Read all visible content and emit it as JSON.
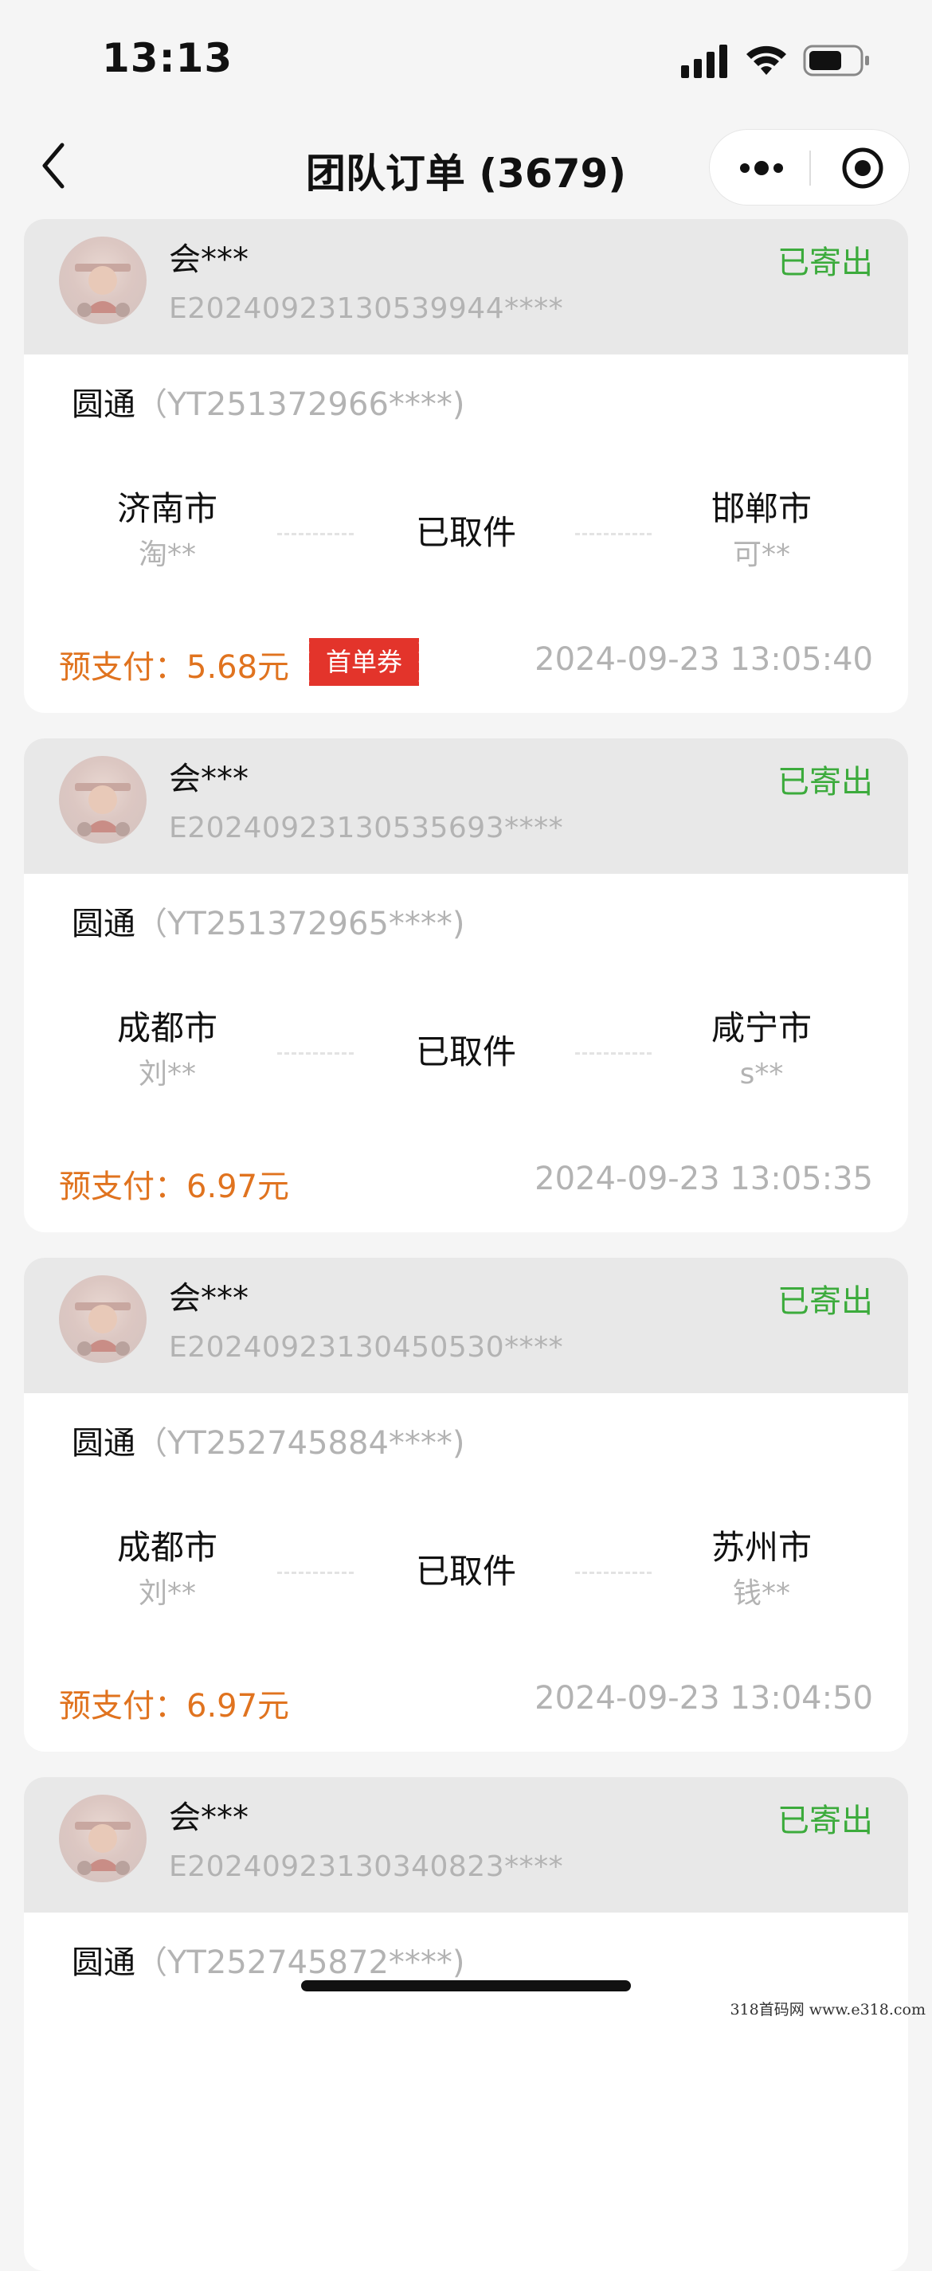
{
  "status_bar": {
    "time": "13:13"
  },
  "nav": {
    "title": "团队订单 (3679)"
  },
  "orders": [
    {
      "user": "会***",
      "order_no": "E20240923130539944****",
      "status": "已寄出",
      "carrier": "圆通",
      "tracking": "（YT251372966****)",
      "from_city": "济南市",
      "from_person": "淘**",
      "to_city": "邯郸市",
      "to_person": "可**",
      "pickup_status": "已取件",
      "prepay": "预支付：5.68元",
      "coupon": "首单券",
      "time": "2024-09-23 13:05:40"
    },
    {
      "user": "会***",
      "order_no": "E20240923130535693****",
      "status": "已寄出",
      "carrier": "圆通",
      "tracking": "（YT251372965****)",
      "from_city": "成都市",
      "from_person": "刘**",
      "to_city": "咸宁市",
      "to_person": "s**",
      "pickup_status": "已取件",
      "prepay": "预支付：6.97元",
      "time": "2024-09-23 13:05:35"
    },
    {
      "user": "会***",
      "order_no": "E20240923130450530****",
      "status": "已寄出",
      "carrier": "圆通",
      "tracking": "（YT252745884****)",
      "from_city": "成都市",
      "from_person": "刘**",
      "to_city": "苏州市",
      "to_person": "钱**",
      "pickup_status": "已取件",
      "prepay": "预支付：6.97元",
      "time": "2024-09-23 13:04:50"
    },
    {
      "user": "会***",
      "order_no": "E20240923130340823****",
      "status": "已寄出",
      "carrier": "圆通",
      "tracking": "（YT252745872****)"
    }
  ],
  "watermark": "318首码网  www.e318.com",
  "colors": {
    "status_green": "#3cab3c",
    "prepay_orange": "#e0731f",
    "coupon_red": "#e3342b",
    "muted_gray": "#b3b3b3"
  },
  "icons": [
    "signal-icon",
    "wifi-icon",
    "battery-icon",
    "back-icon",
    "more-icon",
    "close-mini-program-icon",
    "avatar"
  ]
}
